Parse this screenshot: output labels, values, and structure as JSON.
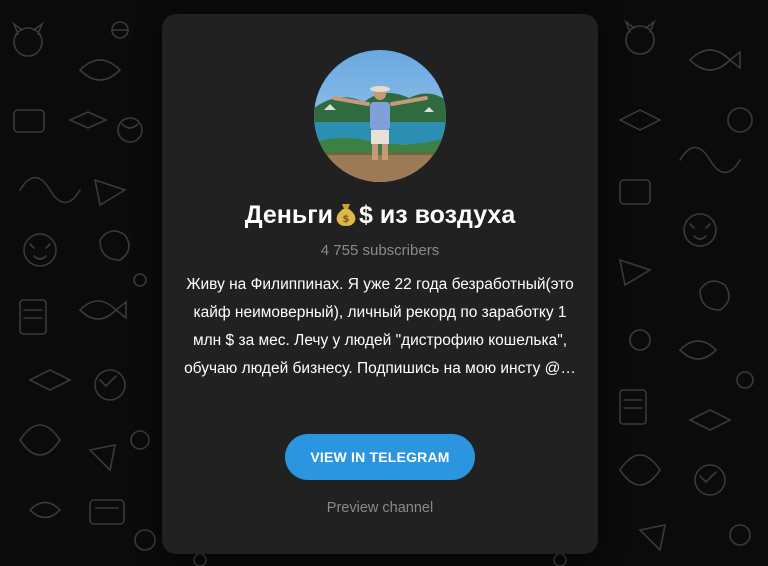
{
  "channel": {
    "title": "Деньги $ из воздуха",
    "title_part1": "Деньги",
    "title_emoji": "money-bag-icon",
    "title_part2": "$ из воздуха",
    "subscribers": "4 755 subscribers",
    "description": "Живу на Филиппинах. Я уже 22 года безработный(это кайф неимоверный), личный рекорд по заработку 1 млн $ за мес. Лечу у людей \"дистрофию кошелька\", обучаю людей бизнесу. Подпишись на мою инсту @…"
  },
  "actions": {
    "view_label": "VIEW IN TELEGRAM",
    "preview_label": "Preview channel"
  },
  "colors": {
    "background": "#0b0b0c",
    "card": "#212121",
    "accent": "#2b95e0",
    "muted_text": "#8a8a8a"
  }
}
